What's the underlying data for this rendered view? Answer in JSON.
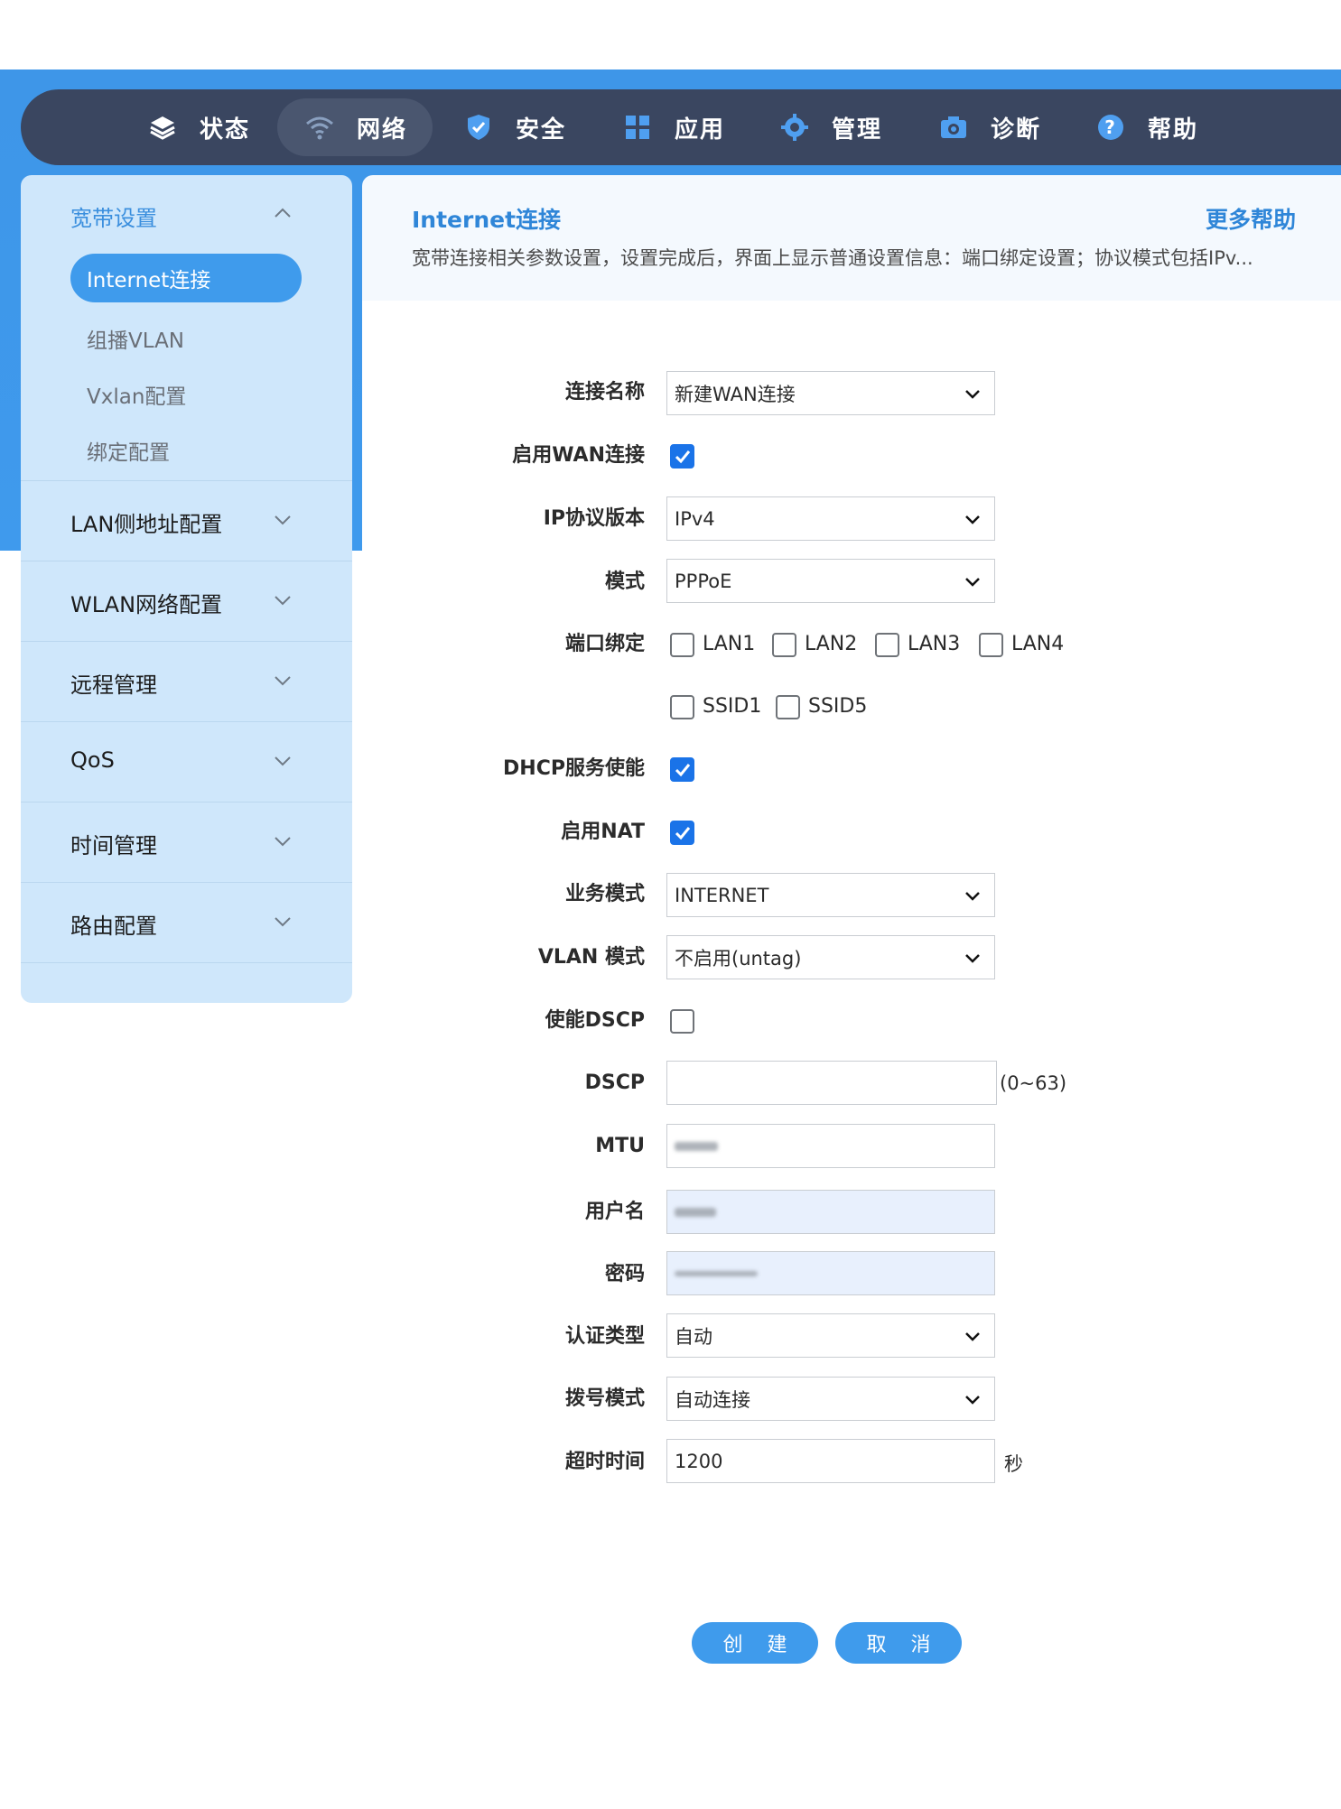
{
  "nav": [
    {
      "label": "状态",
      "icon": "layers-icon"
    },
    {
      "label": "网络",
      "icon": "wifi-icon",
      "active": true
    },
    {
      "label": "安全",
      "icon": "shield-icon"
    },
    {
      "label": "应用",
      "icon": "apps-grid-icon"
    },
    {
      "label": "管理",
      "icon": "gear-icon"
    },
    {
      "label": "诊断",
      "icon": "camera-icon"
    },
    {
      "label": "帮助",
      "icon": "help-icon"
    }
  ],
  "sidebar": {
    "broadband": {
      "title": "宽带设置",
      "items": [
        "Internet连接",
        "组播VLAN",
        "Vxlan配置",
        "绑定配置"
      ]
    },
    "groups": [
      "LAN侧地址配置",
      "WLAN网络配置",
      "远程管理",
      "QoS",
      "时间管理",
      "路由配置"
    ]
  },
  "header": {
    "title": "Internet连接",
    "help": "更多帮助",
    "desc": "宽带连接相关参数设置，设置完成后，界面上显示普通设置信息：端口绑定设置；协议模式包括IPv..."
  },
  "form": {
    "conn_name": {
      "label": "连接名称",
      "value": "新建WAN连接"
    },
    "enable_wan": {
      "label": "启用WAN连接",
      "checked": true
    },
    "ip_version": {
      "label": "IP协议版本",
      "value": "IPv4"
    },
    "mode": {
      "label": "模式",
      "value": "PPPoE"
    },
    "port_bind": {
      "label": "端口绑定",
      "ports": [
        "LAN1",
        "LAN2",
        "LAN3",
        "LAN4"
      ],
      "ssids": [
        "SSID1",
        "SSID5"
      ]
    },
    "dhcp": {
      "label": "DHCP服务使能",
      "checked": true
    },
    "nat": {
      "label": "启用NAT",
      "checked": true
    },
    "service_mode": {
      "label": "业务模式",
      "value": "INTERNET"
    },
    "vlan_mode": {
      "label": "VLAN 模式",
      "value": "不启用(untag)"
    },
    "enable_dscp": {
      "label": "使能DSCP",
      "checked": false
    },
    "dscp": {
      "label": "DSCP",
      "value": "",
      "suffix": "(0~63)"
    },
    "mtu": {
      "label": "MTU"
    },
    "username": {
      "label": "用户名"
    },
    "password": {
      "label": "密码"
    },
    "auth_type": {
      "label": "认证类型",
      "value": "自动"
    },
    "dial_mode": {
      "label": "拨号模式",
      "value": "自动连接"
    },
    "timeout": {
      "label": "超时时间",
      "value": "1200",
      "suffix": "秒"
    }
  },
  "buttons": {
    "create": "创 建",
    "cancel": "取 消"
  },
  "colors": {
    "accent": "#3f9bec",
    "nav_bg": "#3a4660",
    "sidebar_bg": "#cfe7fb",
    "checkbox": "#1a73e8"
  }
}
